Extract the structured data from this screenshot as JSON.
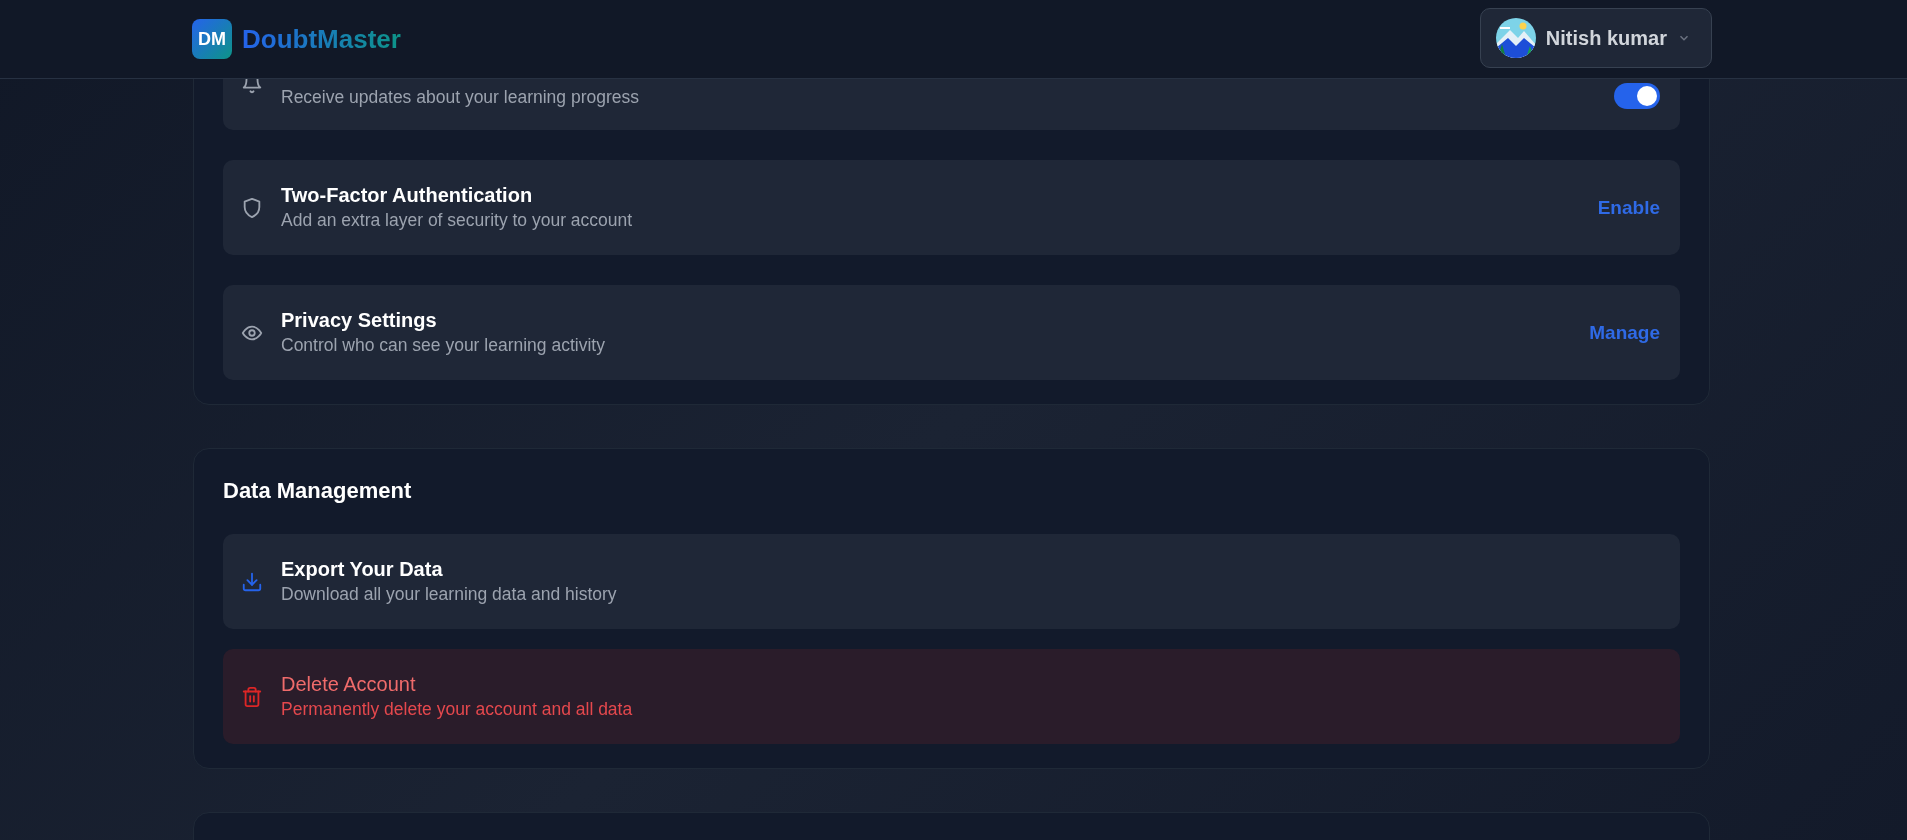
{
  "header": {
    "logo_text": "DM",
    "brand": "DoubtMaster",
    "user": {
      "name": "Nitish kumar"
    }
  },
  "sections": [
    {
      "rows": [
        {
          "kind": "toggle",
          "description": "Receive updates about your learning progress",
          "on": true
        },
        {
          "kind": "action",
          "title": "Two-Factor Authentication",
          "description": "Add an extra layer of security to your account",
          "action": "Enable"
        },
        {
          "kind": "action",
          "title": "Privacy Settings",
          "description": "Control who can see your learning activity",
          "action": "Manage"
        }
      ]
    },
    {
      "title": "Data Management",
      "rows": [
        {
          "kind": "link",
          "title": "Export Your Data",
          "description": "Download all your learning data and history",
          "danger": false
        },
        {
          "kind": "link",
          "title": "Delete Account",
          "description": "Permanently delete your account and all data",
          "danger": true
        }
      ]
    }
  ]
}
